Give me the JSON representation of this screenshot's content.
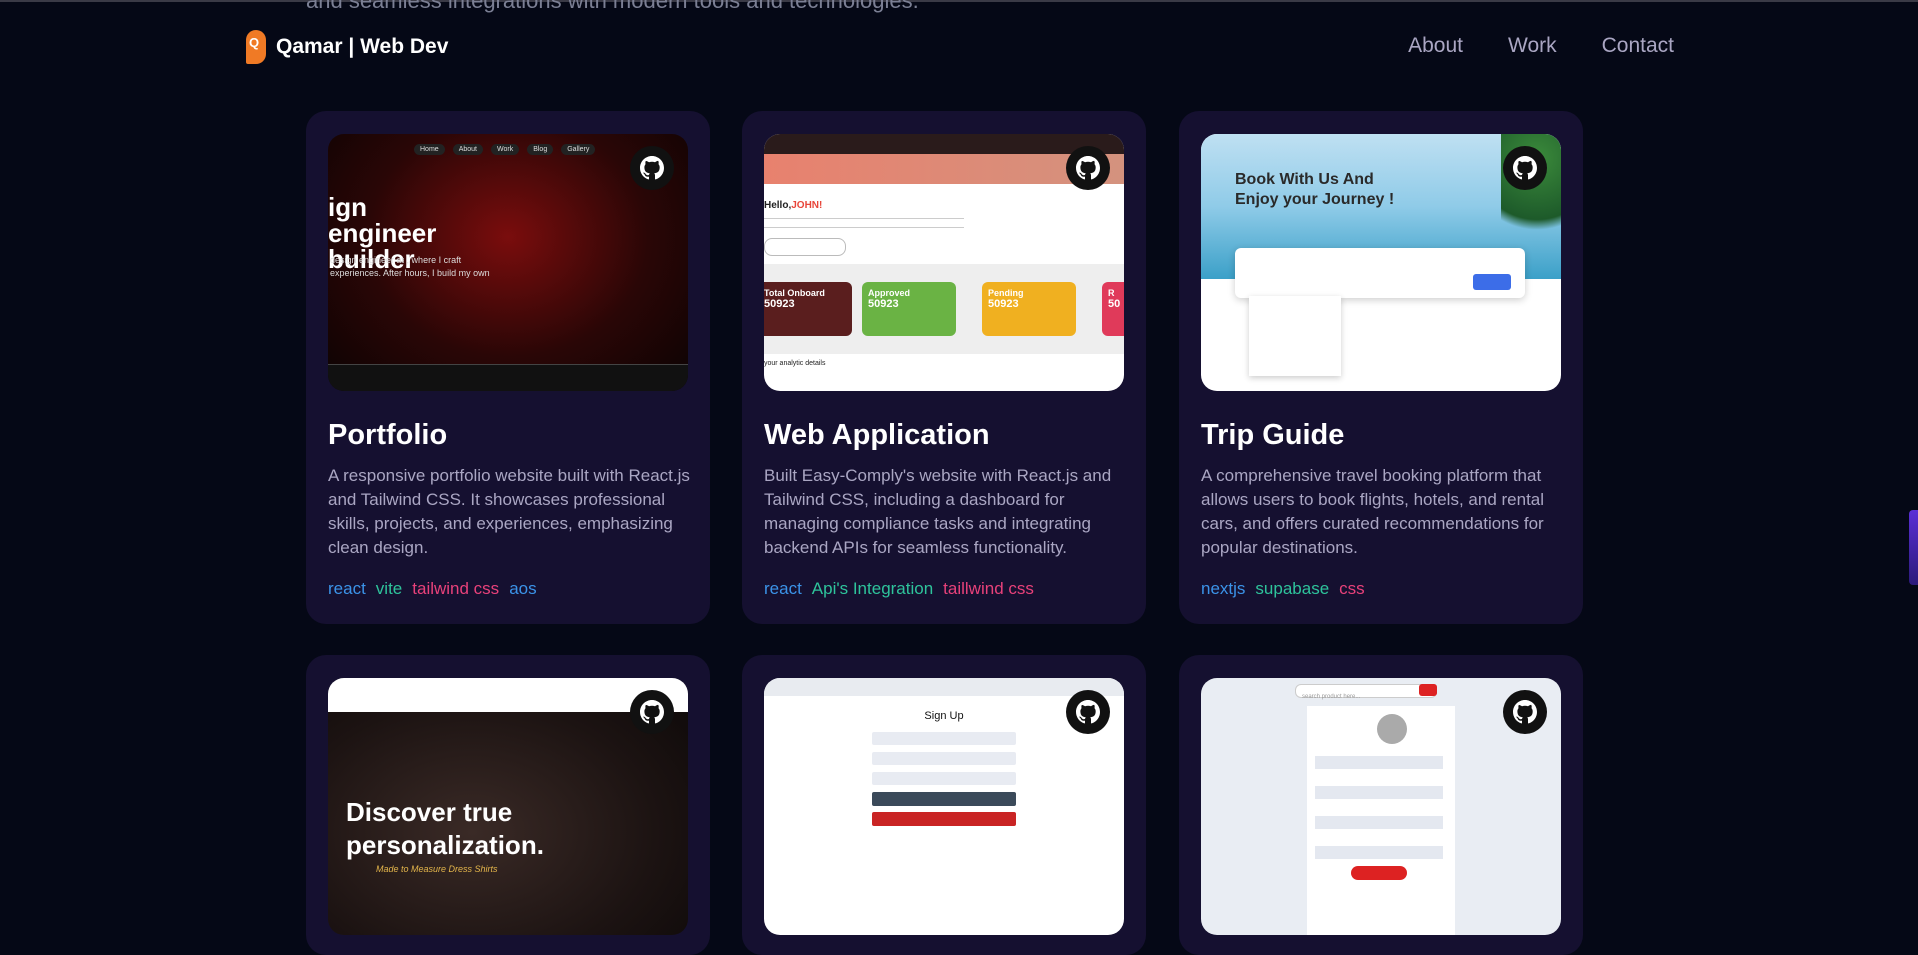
{
  "intro": {
    "text": "and seamless integrations with modern tools and technologies."
  },
  "header": {
    "logo_letter": "Q",
    "logo_text": "Qamar | Web Dev",
    "nav": [
      "About",
      "Work",
      "Contact"
    ]
  },
  "projects": [
    {
      "title": "Portfolio",
      "description": "A responsive portfolio website built with React.js and Tailwind CSS. It showcases professional skills, projects, and experiences, emphasizing clean design.",
      "tags": [
        "react",
        "vite",
        "tailwind css",
        "aos"
      ],
      "thumb": {
        "menu": [
          "Home",
          "About",
          "Work",
          "Blog",
          "Gallery"
        ],
        "heading": "ign engineer builder",
        "text": "design engineer at , where I craft experiences. After hours, I build my own"
      }
    },
    {
      "title": "Web Application",
      "description": "Built Easy-Comply's website with React.js and Tailwind CSS, including a dashboard for managing compliance tasks and integrating backend APIs for seamless functionality.",
      "tags": [
        "react",
        "Api's Integration",
        "taillwind css"
      ],
      "thumb": {
        "greeting": "Hello,",
        "name": "JOHN!",
        "kpis": [
          {
            "label": "Total Onboard",
            "value": "50923",
            "color": "#5a1e1e"
          },
          {
            "label": "Approved",
            "value": "50923",
            "color": "#6ab344"
          },
          {
            "label": "Pending",
            "value": "50923",
            "color": "#f0b020"
          },
          {
            "label": "R",
            "value": "50",
            "color": "#e03a5a"
          }
        ],
        "section": "your analytic details"
      }
    },
    {
      "title": "Trip Guide",
      "description": "A comprehensive travel booking platform that allows users to book flights, hotels, and rental cars, and offers curated recommendations for popular destinations.",
      "tags": [
        "nextjs",
        "supabase",
        "css"
      ],
      "thumb": {
        "heading": "Book With Us And Enjoy your Journey !"
      }
    },
    {
      "thumb": {
        "heading": "Discover true personalization.",
        "subtext": "Made to Measure Dress Shirts"
      }
    },
    {
      "thumb": {
        "heading": "Sign Up"
      }
    },
    {
      "thumb": {
        "search_placeholder": "search product here..."
      }
    }
  ],
  "tag_colors": {
    "blue": "#3b93e8",
    "green": "#2ec39b",
    "pink": "#e8417a"
  },
  "icons": {
    "card_link": "github-icon"
  }
}
